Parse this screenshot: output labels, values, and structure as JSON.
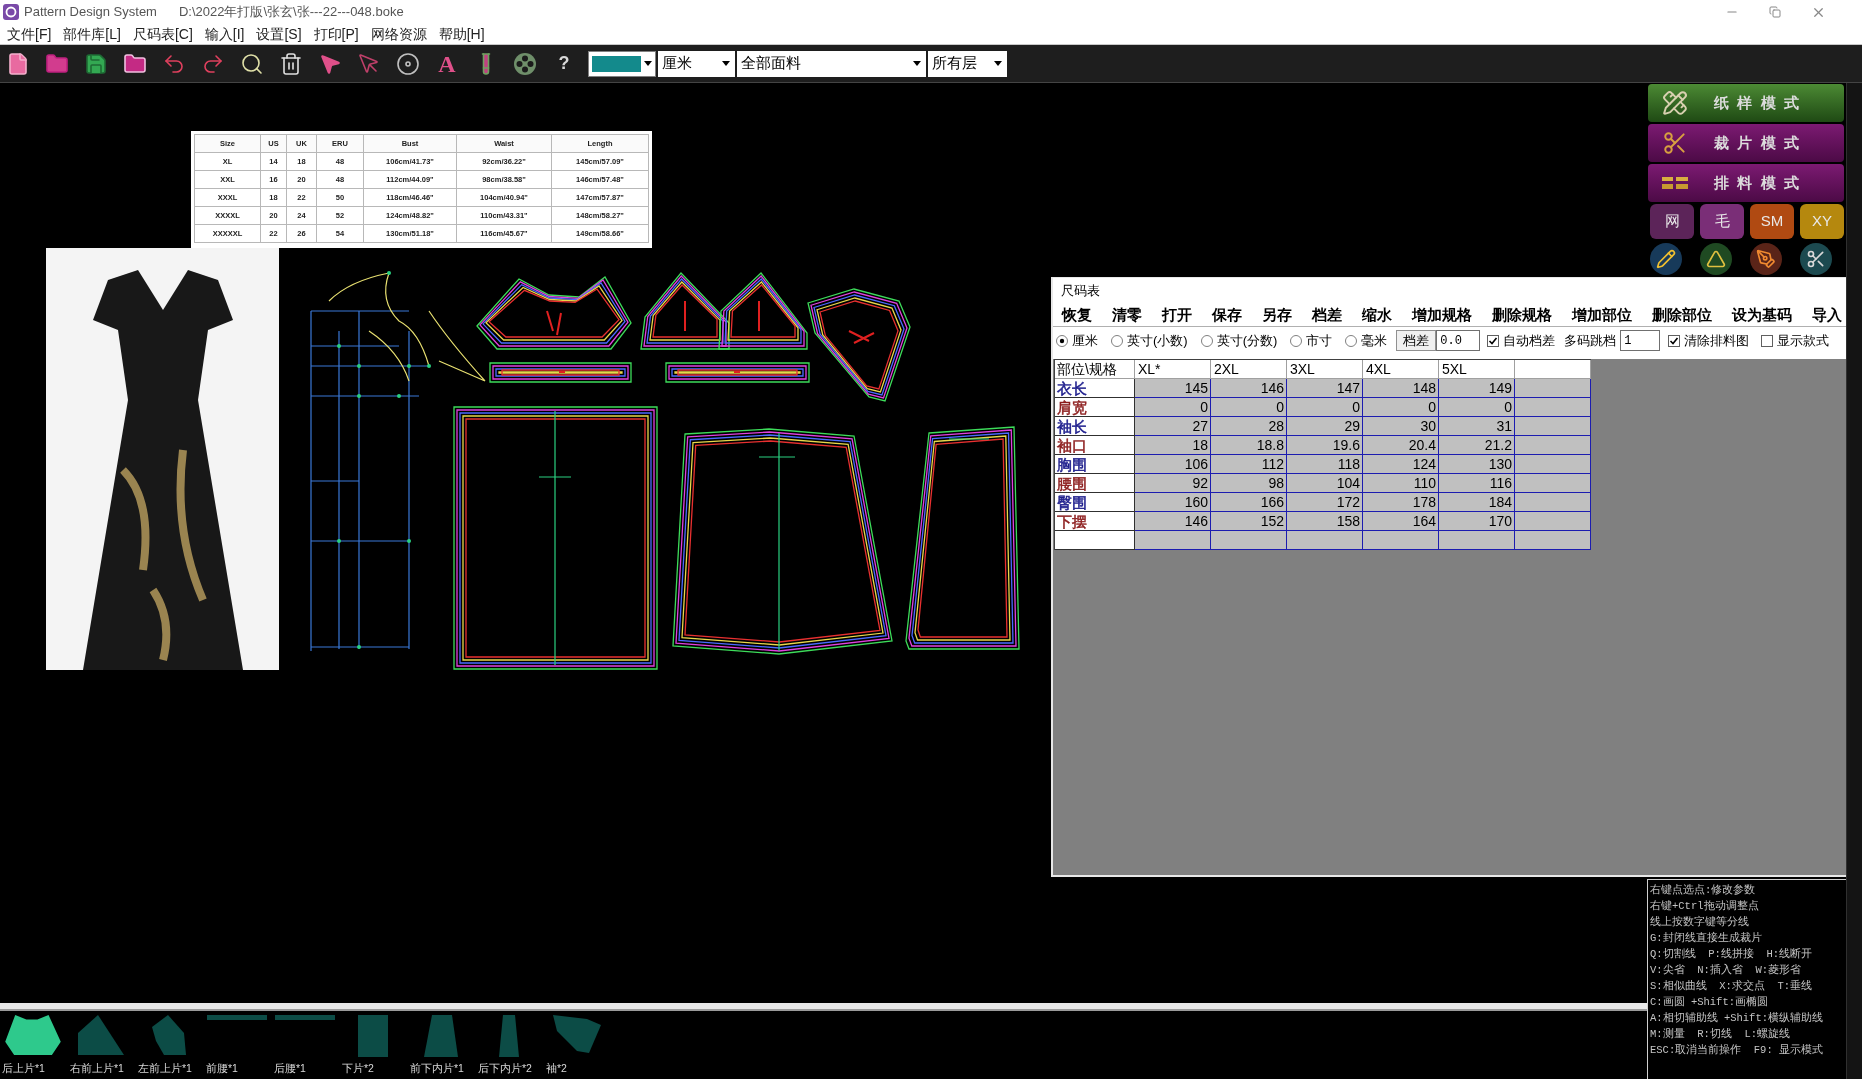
{
  "title_bar": {
    "app_name": "Pattern Design System",
    "file_path": "D:\\2022年打版\\张玄\\张---22---048.boke"
  },
  "menu": [
    "文件[F]",
    "部件库[L]",
    "尺码表[C]",
    "输入[I]",
    "设置[S]",
    "打印[P]",
    "网络资源",
    "帮助[H]"
  ],
  "toolbar": {
    "text_tool": "A",
    "help": "?",
    "color_picker": {
      "color": "#138a8c"
    },
    "unit": "厘米",
    "fabric": "全部面料",
    "layer": "所有层"
  },
  "size_chart_image": {
    "columns": [
      "Size",
      "US",
      "UK",
      "ERU",
      "Bust",
      "Waist",
      "Length"
    ],
    "rows": [
      [
        "XL",
        "14",
        "18",
        "48",
        "106cm/41.73\"",
        "92cm/36.22\"",
        "145cm/57.09\""
      ],
      [
        "XXL",
        "16",
        "20",
        "48",
        "112cm/44.09\"",
        "98cm/38.58\"",
        "146cm/57.48\""
      ],
      [
        "XXXL",
        "18",
        "22",
        "50",
        "118cm/46.46\"",
        "104cm/40.94\"",
        "147cm/57.87\""
      ],
      [
        "XXXXL",
        "20",
        "24",
        "52",
        "124cm/48.82\"",
        "110cm/43.31\"",
        "148cm/58.27\""
      ],
      [
        "XXXXXL",
        "22",
        "26",
        "54",
        "130cm/51.18\"",
        "116cm/45.67\"",
        "149cm/58.66\""
      ]
    ]
  },
  "mode_panel": {
    "modes": [
      {
        "label": "纸样模式",
        "kind": "paper",
        "selected": true
      },
      {
        "label": "裁片模式",
        "kind": "cut",
        "selected": false
      },
      {
        "label": "排料模式",
        "kind": "layout",
        "selected": false
      }
    ],
    "quick_buttons": [
      {
        "label": "网",
        "color": "#5c2459"
      },
      {
        "label": "毛",
        "color": "#7a2e77"
      },
      {
        "label": "SM",
        "color": "#b04a12"
      },
      {
        "label": "XY",
        "color": "#b5880e"
      }
    ]
  },
  "size_dialog": {
    "title": "尺码表",
    "actions": [
      "恢复",
      "清零",
      "打开",
      "保存",
      "另存",
      "档差",
      "缩水",
      "增加规格",
      "删除规格",
      "增加部位",
      "删除部位",
      "设为基码",
      "导入"
    ],
    "units": [
      {
        "label": "厘米",
        "selected": true
      },
      {
        "label": "英寸(小数)",
        "selected": false
      },
      {
        "label": "英寸(分数)",
        "selected": false
      },
      {
        "label": "市寸",
        "selected": false
      },
      {
        "label": "毫米",
        "selected": false
      }
    ],
    "grade_button": "档差",
    "grade_value": "0.0",
    "auto_grade": {
      "label": "自动档差",
      "checked": true
    },
    "skip_label": "多码跳档",
    "skip_value": "1",
    "clear_layout": {
      "label": "清除排料图",
      "checked": true
    },
    "show_style": {
      "label": "显示款式",
      "checked": false
    },
    "table": {
      "corner": "部位\\规格",
      "columns": [
        "XL*",
        "2XL",
        "3XL",
        "4XL",
        "5XL"
      ],
      "rows": [
        {
          "name": "衣长",
          "color": "#1c1c8c",
          "values": [
            "145",
            "146",
            "147",
            "148",
            "149"
          ]
        },
        {
          "name": "肩宽",
          "color": "#8c1c1c",
          "values": [
            "0",
            "0",
            "0",
            "0",
            "0"
          ]
        },
        {
          "name": "袖长",
          "color": "#1c1c8c",
          "values": [
            "27",
            "28",
            "29",
            "30",
            "31"
          ]
        },
        {
          "name": "袖口",
          "color": "#8c1c1c",
          "values": [
            "18",
            "18.8",
            "19.6",
            "20.4",
            "21.2"
          ]
        },
        {
          "name": "胸围",
          "color": "#1c1c8c",
          "values": [
            "106",
            "112",
            "118",
            "124",
            "130"
          ]
        },
        {
          "name": "腰围",
          "color": "#8c1c1c",
          "values": [
            "92",
            "98",
            "104",
            "110",
            "116"
          ]
        },
        {
          "name": "臀围",
          "color": "#1c1c8c",
          "values": [
            "160",
            "166",
            "172",
            "178",
            "184"
          ]
        },
        {
          "name": "下摆",
          "color": "#8c1c1c",
          "values": [
            "146",
            "152",
            "158",
            "164",
            "170"
          ]
        }
      ]
    }
  },
  "pieces": [
    {
      "label": "后上片*1",
      "kind": "yoke",
      "selected": true
    },
    {
      "label": "右前上片*1",
      "kind": "wedge",
      "selected": false
    },
    {
      "label": "左前上片*1",
      "kind": "slant",
      "selected": false
    },
    {
      "label": "前腰*1",
      "kind": "band",
      "selected": false
    },
    {
      "label": "后腰*1",
      "kind": "band",
      "selected": false
    },
    {
      "label": "下片*2",
      "kind": "rect",
      "selected": false
    },
    {
      "label": "前下内片*1",
      "kind": "flare",
      "selected": false
    },
    {
      "label": "后下内片*2",
      "kind": "taper",
      "selected": false
    },
    {
      "label": "袖*2",
      "kind": "sleeve",
      "selected": false
    }
  ],
  "help_lines": [
    "右键点选点:修改参数",
    "右键+Ctrl拖动调整点",
    "线上按数字键等分线",
    "G:封闭线直接生成裁片",
    "Q:切割线  P:线拼接  H:线断开",
    "V:尖省  N:插入省  W:菱形省",
    "S:相似曲线  X:求交点  T:垂线",
    "C:画圆 +Shift:画椭圆",
    "A:相切辅助线 +Shift:横纵辅助线",
    "M:测量  R:切线  L:螺旋线",
    "ESC:取消当前操作  F9: 显示模式"
  ]
}
